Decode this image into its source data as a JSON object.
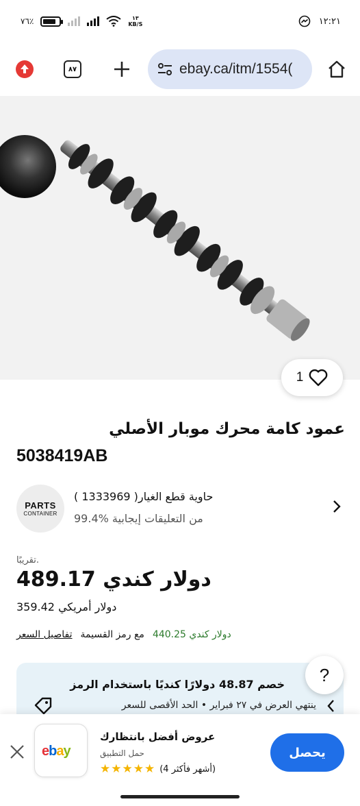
{
  "status_bar": {
    "battery_percent": "٧٦٪",
    "network_speed": "١٣",
    "network_speed_unit": "KB/S",
    "time": "١٢:٢١"
  },
  "browser": {
    "tab_count": "٨٧",
    "url": "ebay.ca/itm/1554("
  },
  "product": {
    "likes": "1",
    "title_line1": "عمود كامة محرك موبار الأصلي",
    "title_line2": "5038419AB"
  },
  "seller": {
    "logo_line1": "PARTS",
    "logo_line2": "CONTAINER",
    "name": "( 1333969 )حاوية قطع الغيار",
    "feedback": "99.4% من التعليقات إيجابية"
  },
  "price": {
    "approx_label": "تقريبًا.",
    "main": "489.17 دولار كندي",
    "usd": "359.42 دولار أمريكي",
    "details_link": "تفاصيل السعر",
    "coupon_text": "مع رمز القسيمة",
    "coupon_price": "440.25 دولار كندي"
  },
  "promo": {
    "title": "خصم 48.87 دولارًا كنديًا باستخدام الرمز",
    "subtitle": "ينتهي العرض في ٢٧ فبراير • الحد الأقصى للسعر"
  },
  "help": {
    "label": "?"
  },
  "app_banner": {
    "title": "عروض أفضل بانتظارك",
    "subtitle": "حمل التطبيق",
    "stars": "★★★★★",
    "rating_text": "(4 أشهر فأكثر)",
    "logo_text": "ebay",
    "get_label": "يحصل"
  },
  "colors": {
    "url_pill": "#dde5f6",
    "accent_blue": "#1f6fe8",
    "promo_bg": "#e7f2f8",
    "coupon_green": "#2b7a2b",
    "star_gold": "#f4b400",
    "ebay_red": "#e53238",
    "ebay_blue": "#0064d2",
    "ebay_yellow": "#f5af02",
    "ebay_green": "#86b817"
  }
}
